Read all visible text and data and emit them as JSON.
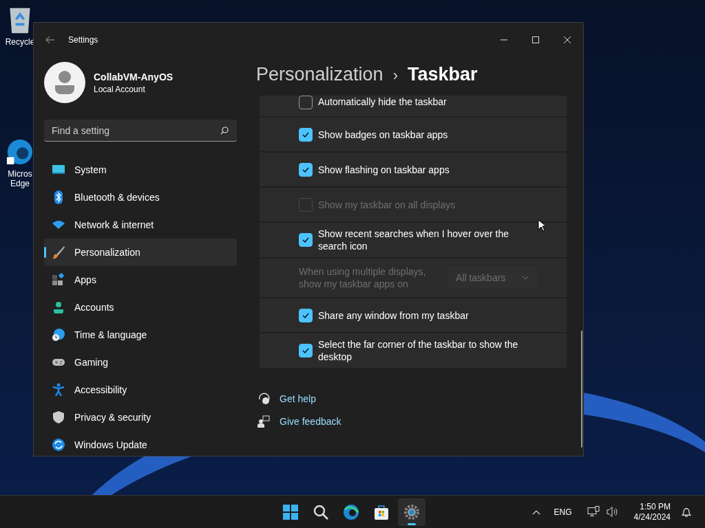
{
  "desktop_icons": [
    {
      "lines": [
        "Recycle"
      ]
    },
    {
      "lines": [
        "Micros",
        "Edge"
      ]
    }
  ],
  "window": {
    "title": "Settings"
  },
  "profile": {
    "name": "CollabVM-AnyOS",
    "account_type": "Local Account"
  },
  "search": {
    "placeholder": "Find a setting"
  },
  "sidebar": {
    "items": [
      {
        "label": "System",
        "selected": false
      },
      {
        "label": "Bluetooth & devices",
        "selected": false
      },
      {
        "label": "Network & internet",
        "selected": false
      },
      {
        "label": "Personalization",
        "selected": true
      },
      {
        "label": "Apps",
        "selected": false
      },
      {
        "label": "Accounts",
        "selected": false
      },
      {
        "label": "Time & language",
        "selected": false
      },
      {
        "label": "Gaming",
        "selected": false
      },
      {
        "label": "Accessibility",
        "selected": false
      },
      {
        "label": "Privacy & security",
        "selected": false
      },
      {
        "label": "Windows Update",
        "selected": false
      }
    ]
  },
  "breadcrumb": {
    "parent": "Personalization",
    "separator": "›",
    "current": "Taskbar"
  },
  "settings": [
    {
      "kind": "checkbox",
      "label": "Automatically hide the taskbar",
      "checked": false,
      "disabled": false
    },
    {
      "kind": "checkbox",
      "label": "Show badges on taskbar apps",
      "checked": true,
      "disabled": false
    },
    {
      "kind": "checkbox",
      "label": "Show flashing on taskbar apps",
      "checked": true,
      "disabled": false
    },
    {
      "kind": "checkbox",
      "label": "Show my taskbar on all displays",
      "checked": false,
      "disabled": true
    },
    {
      "kind": "checkbox",
      "label": "Show recent searches when I hover over the search icon",
      "checked": true,
      "disabled": false
    },
    {
      "kind": "dropdown",
      "label": "When using multiple displays, show my taskbar apps on",
      "value": "All taskbars",
      "disabled": true
    },
    {
      "kind": "checkbox",
      "label": "Share any window from my taskbar",
      "checked": true,
      "disabled": false
    },
    {
      "kind": "checkbox",
      "label": "Select the far corner of the taskbar to show the desktop",
      "checked": true,
      "disabled": false
    }
  ],
  "help_links": [
    "Get help",
    "Give feedback"
  ],
  "taskbar": {
    "apps": [
      {
        "selected": false
      },
      {
        "selected": false
      },
      {
        "selected": false
      },
      {
        "selected": false
      },
      {
        "selected": true
      }
    ],
    "language": "ENG",
    "time": "1:50 PM",
    "date": "4/24/2024"
  }
}
